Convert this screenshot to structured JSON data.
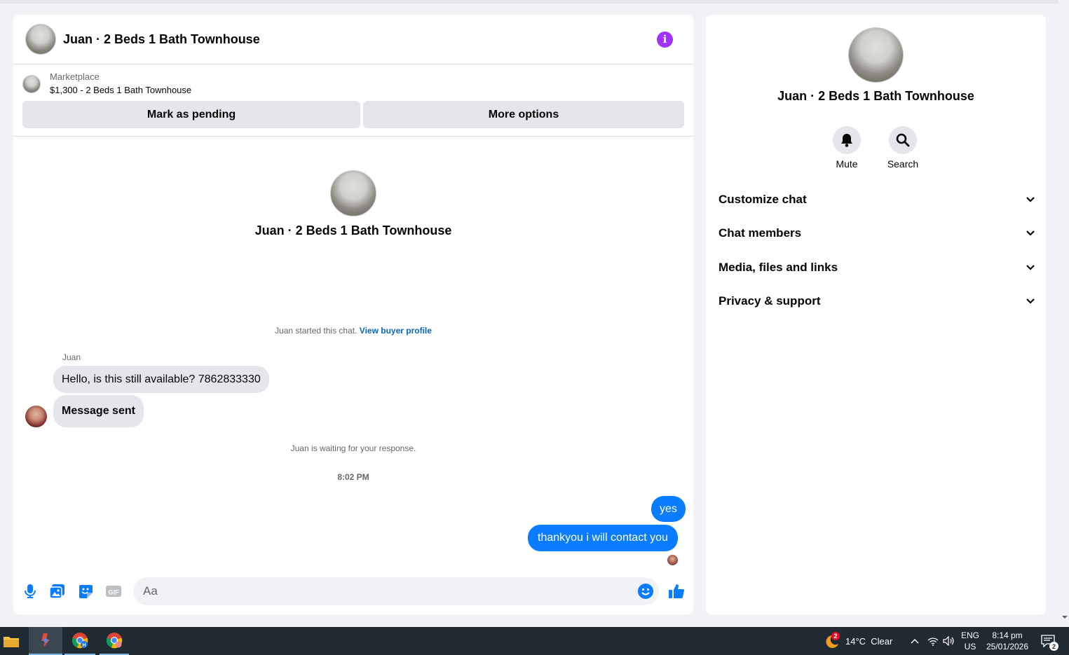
{
  "chat": {
    "title": "Juan · 2 Beds 1 Bath Townhouse",
    "marketplace_label": "Marketplace",
    "listing": "$1,300 - 2 Beds 1 Bath Townhouse",
    "mark_pending": "Mark as pending",
    "more_options": "More options",
    "intro_name": "Juan · 2 Beds 1 Bath Townhouse",
    "started_text": "Juan started this chat.",
    "view_buyer": "View buyer profile",
    "sender": "Juan",
    "messages": [
      {
        "text": "Hello, is this still available? 7862833330",
        "direction": "in"
      },
      {
        "text": "Message sent",
        "direction": "in"
      },
      {
        "text": "yes",
        "direction": "out"
      },
      {
        "text": "thankyou i will contact you",
        "direction": "out"
      }
    ],
    "waiting": "Juan is waiting for your response.",
    "time": "8:02 PM",
    "input_placeholder": "Aa",
    "accent_color": "#0a7cff"
  },
  "side": {
    "name": "Juan · 2 Beds 1 Bath Townhouse",
    "actions": [
      "Mute",
      "Search"
    ],
    "sections": [
      "Customize chat",
      "Chat members",
      "Media, files and links",
      "Privacy & support"
    ]
  },
  "taskbar": {
    "weather_badge": "2",
    "weather": "14°C  Clear",
    "lang": "ENG",
    "region": "US",
    "time": "8:14 pm",
    "date": "25/01/2026",
    "notif_count": "2"
  }
}
